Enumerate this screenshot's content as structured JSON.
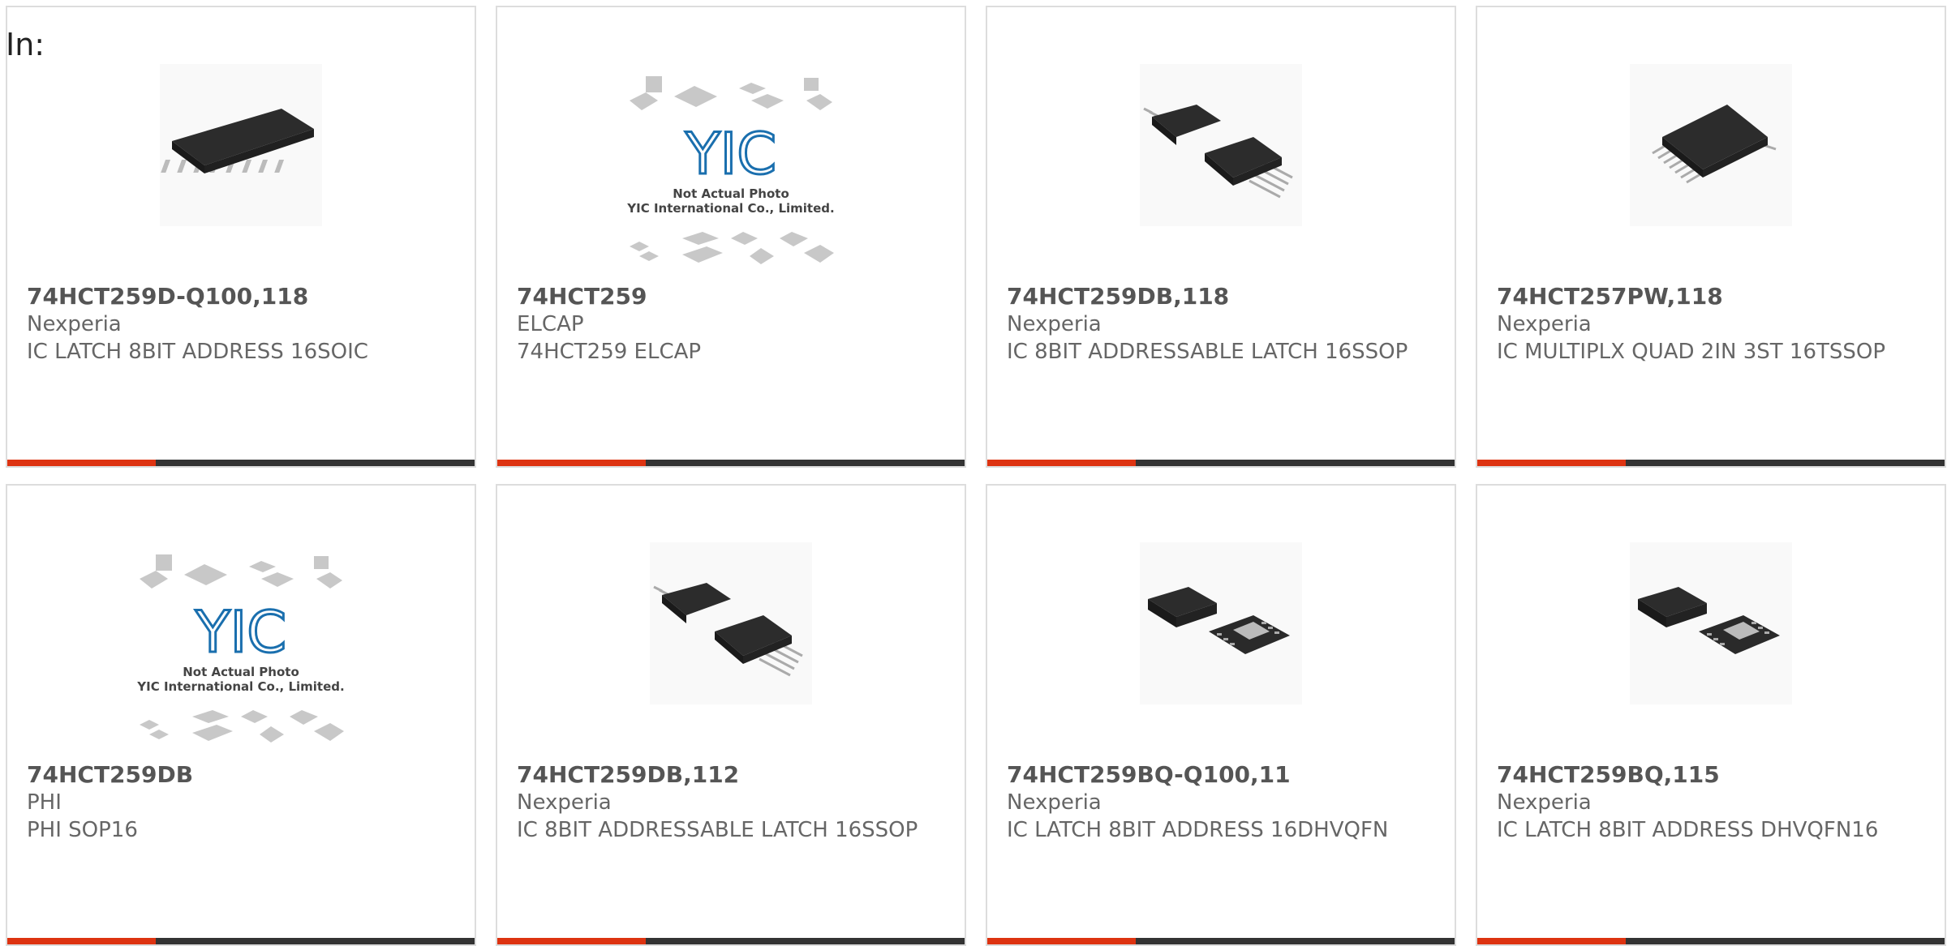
{
  "page": {
    "in_label": "In:"
  },
  "colors": {
    "accent": "#dd3311",
    "bar": "#333333",
    "border": "#dddddd",
    "text": "#666666",
    "placeholder_logo": "#1a6fae"
  },
  "placeholder": {
    "logo_text": "YIC",
    "line1": "Not Actual Photo",
    "line2": "YIC International Co., Limited."
  },
  "products": [
    {
      "part": "74HCT259D-Q100,118",
      "maker": "Nexperia",
      "desc": "IC LATCH 8BIT ADDRESS 16SOIC",
      "image": "soic-chip-icon"
    },
    {
      "part": "74HCT259",
      "maker": "ELCAP",
      "desc": "74HCT259 ELCAP",
      "image": "not-actual-photo-placeholder"
    },
    {
      "part": "74HCT259DB,118",
      "maker": "Nexperia",
      "desc": "IC 8BIT ADDRESSABLE LATCH 16SSOP",
      "image": "ssop-chip-pair-icon"
    },
    {
      "part": "74HCT257PW,118",
      "maker": "Nexperia",
      "desc": "IC MULTIPLX QUAD 2IN 3ST 16TSSOP",
      "image": "tssop-chip-icon"
    },
    {
      "part": "74HCT259DB",
      "maker": "PHI",
      "desc": "PHI SOP16",
      "image": "not-actual-photo-placeholder"
    },
    {
      "part": "74HCT259DB,112",
      "maker": "Nexperia",
      "desc": "IC 8BIT ADDRESSABLE LATCH 16SSOP",
      "image": "ssop-chip-pair-icon"
    },
    {
      "part": "74HCT259BQ-Q100,11",
      "maker": "Nexperia",
      "desc": "IC LATCH 8BIT ADDRESS 16DHVQFN",
      "image": "qfn-chip-pair-icon"
    },
    {
      "part": "74HCT259BQ,115",
      "maker": "Nexperia",
      "desc": "IC LATCH 8BIT ADDRESS DHVQFN16",
      "image": "qfn-chip-pair-icon"
    }
  ]
}
